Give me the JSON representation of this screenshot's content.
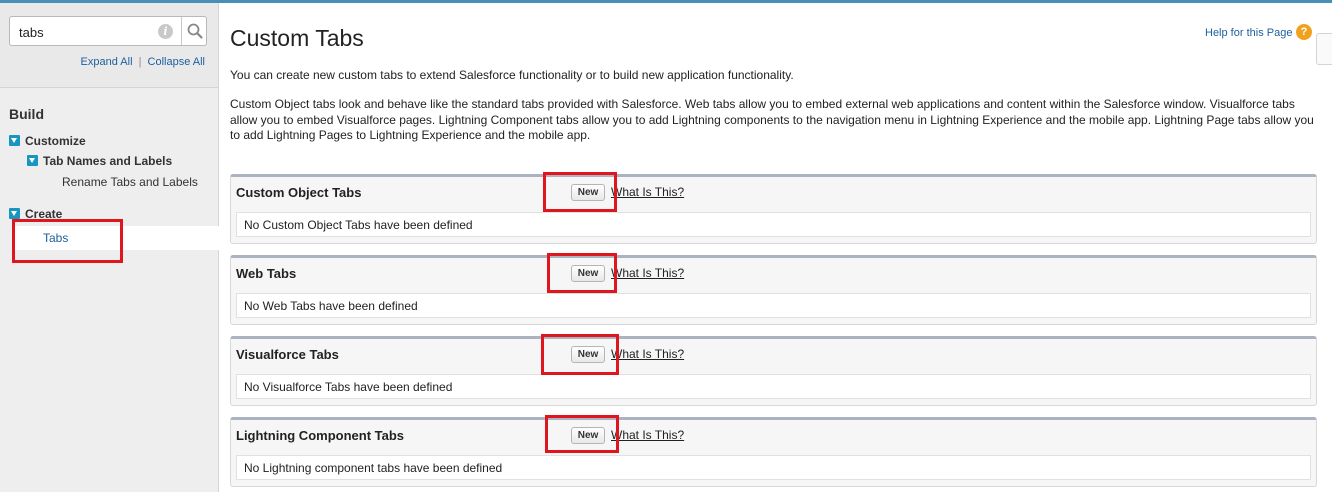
{
  "sidebar": {
    "search": {
      "value": "tabs",
      "placeholder": ""
    },
    "expand_all": "Expand All",
    "separator": "|",
    "collapse_all": "Collapse All",
    "build_heading": "Build",
    "tree": {
      "customize": "Customize",
      "tab_names_and_labels": "Tab Names and Labels",
      "rename_tabs_and_labels": "Rename Tabs and Labels",
      "create": "Create",
      "tabs": "Tabs"
    }
  },
  "main": {
    "title": "Custom Tabs",
    "help_link": "Help for this Page",
    "intro": "You can create new custom tabs to extend Salesforce functionality or to build new application functionality.",
    "description": "Custom Object tabs look and behave like the standard tabs provided with Salesforce. Web tabs allow you to embed external web applications and content within the Salesforce window. Visualforce tabs allow you to embed Visualforce pages. Lightning Component tabs allow you to add Lightning components to the navigation menu in Lightning Experience and the mobile app. Lightning Page tabs allow you to add Lightning Pages to Lightning Experience and the mobile app.",
    "sections": [
      {
        "title": "Custom Object Tabs",
        "new_label": "New",
        "what_link": "What Is This?",
        "empty_text": "No Custom Object Tabs have been defined"
      },
      {
        "title": "Web Tabs",
        "new_label": "New",
        "what_link": "What Is This?",
        "empty_text": "No Web Tabs have been defined"
      },
      {
        "title": "Visualforce Tabs",
        "new_label": "New",
        "what_link": "What Is This?",
        "empty_text": "No Visualforce Tabs have been defined"
      },
      {
        "title": "Lightning Component Tabs",
        "new_label": "New",
        "what_link": "What Is This?",
        "empty_text": "No Lightning component tabs have been defined"
      }
    ]
  },
  "colors": {
    "link": "#1b5f9e",
    "highlight_box": "#e0161e",
    "tree_toggle": "#1797c0",
    "help_icon": "#f0a21f",
    "section_border": "#aab3bf"
  },
  "icons": {
    "search": "search-icon",
    "info": "info-icon",
    "help": "help-icon",
    "tree_toggle": "chevron-down-icon"
  }
}
